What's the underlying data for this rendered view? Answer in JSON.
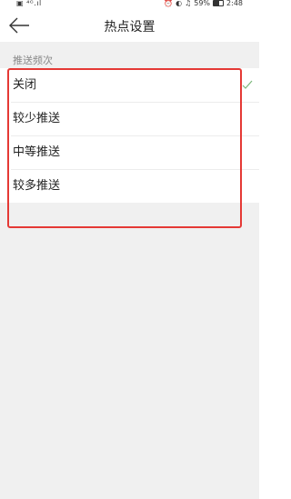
{
  "status_bar": {
    "left": "▣ ⁴ᴳ.ıl",
    "battery": "59%",
    "time": "2:48",
    "icons": [
      "alarm-icon",
      "dnd-icon",
      "silent-icon"
    ]
  },
  "header": {
    "title": "热点设置",
    "back_icon": "arrow-left-icon"
  },
  "section": {
    "label": "推送频次"
  },
  "options": [
    {
      "label": "关闭",
      "selected": true
    },
    {
      "label": "较少推送",
      "selected": false
    },
    {
      "label": "中等推送",
      "selected": false
    },
    {
      "label": "较多推送",
      "selected": false
    }
  ],
  "colors": {
    "check": "#7cb87c",
    "highlight": "#e53935",
    "background": "#f0f0f0"
  }
}
